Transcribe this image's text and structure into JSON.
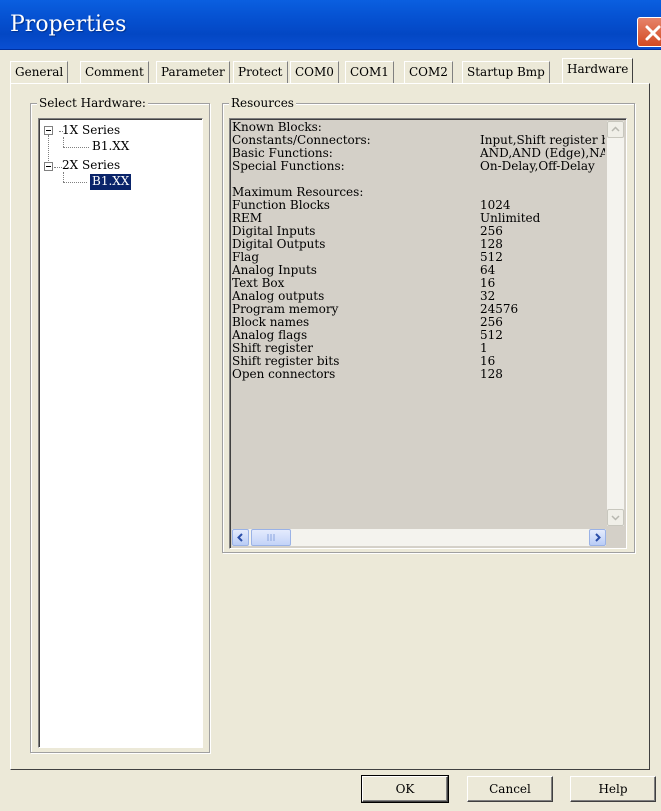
{
  "window": {
    "title": "Properties"
  },
  "tabs": [
    {
      "label": "General"
    },
    {
      "label": "Comment"
    },
    {
      "label": "Parameter"
    },
    {
      "label": "Protect"
    },
    {
      "label": "COM0"
    },
    {
      "label": "COM1"
    },
    {
      "label": "COM2"
    },
    {
      "label": "Startup Bmp"
    },
    {
      "label": "Hardware",
      "active": true
    }
  ],
  "select_hardware": {
    "label": "Select Hardware:",
    "tree": [
      {
        "label": "1X Series",
        "child": "B1.XX"
      },
      {
        "label": "2X Series",
        "child": "B1.XX",
        "selected": true
      }
    ]
  },
  "resources": {
    "label": "Resources",
    "known_blocks_heading": "Known Blocks:",
    "known_blocks": [
      {
        "name": "Constants/Connectors:",
        "value": "Input,Shift register bits"
      },
      {
        "name": "Basic Functions:",
        "value": "AND,AND (Edge),NAND"
      },
      {
        "name": "Special Functions:",
        "value": "On-Delay,Off-Delay"
      }
    ],
    "maximum_heading": "Maximum Resources:",
    "maximum": [
      {
        "name": "Function Blocks",
        "value": "1024"
      },
      {
        "name": "REM",
        "value": "Unlimited"
      },
      {
        "name": "Digital Inputs",
        "value": "256"
      },
      {
        "name": "Digital Outputs",
        "value": "128"
      },
      {
        "name": "Flag",
        "value": "512"
      },
      {
        "name": "Analog Inputs",
        "value": "64"
      },
      {
        "name": "Text Box",
        "value": "16"
      },
      {
        "name": "Analog outputs",
        "value": "32"
      },
      {
        "name": "Program memory",
        "value": "24576"
      },
      {
        "name": "Block names",
        "value": "256"
      },
      {
        "name": "Analog flags",
        "value": "512"
      },
      {
        "name": "Shift register",
        "value": "1"
      },
      {
        "name": "Shift register bits",
        "value": "16"
      },
      {
        "name": "Open connectors",
        "value": "128"
      }
    ]
  },
  "buttons": {
    "ok": "OK",
    "cancel": "Cancel",
    "help": "Help"
  }
}
